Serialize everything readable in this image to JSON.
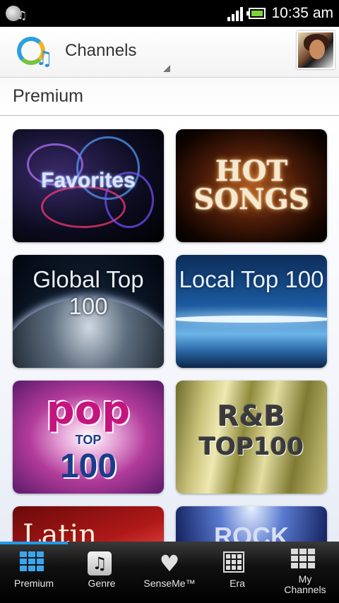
{
  "status_bar": {
    "time": "10:35 am",
    "left_icons": [
      "cd-icon",
      "music-note-icon"
    ],
    "right_icons": [
      "signal-icon",
      "battery-icon"
    ]
  },
  "action_bar": {
    "title": "Channels",
    "logo_icon": "music-unlimited-logo",
    "avatar_icon": "user-avatar"
  },
  "section": {
    "title": "Premium"
  },
  "channels": [
    {
      "label": "Favorites"
    },
    {
      "label_line1": "HOT",
      "label_line2": "SONGS"
    },
    {
      "label": "Global Top 100"
    },
    {
      "label": "Local Top 100"
    },
    {
      "label_pop": "pop",
      "label_top": "TOP",
      "label_num": "100"
    },
    {
      "label_line1": "R&B",
      "label_line2": "TOP100"
    },
    {
      "label": "Latin"
    },
    {
      "label": "ROCK"
    }
  ],
  "bottom_nav": {
    "items": [
      {
        "label": "Premium",
        "icon": "premium-grid-icon",
        "active": true
      },
      {
        "label": "Genre",
        "icon": "genre-music-icon",
        "active": false
      },
      {
        "label": "SenseMe™",
        "icon": "senseme-heart-icon",
        "active": false
      },
      {
        "label": "Era",
        "icon": "era-grid-icon",
        "active": false
      },
      {
        "label_line1": "My",
        "label_line2": "Channels",
        "icon": "my-channels-heart-icon",
        "active": false
      }
    ]
  },
  "colors": {
    "accent": "#1e9be8",
    "statusbar_bg": "#000000",
    "nav_bg": "#111111"
  }
}
